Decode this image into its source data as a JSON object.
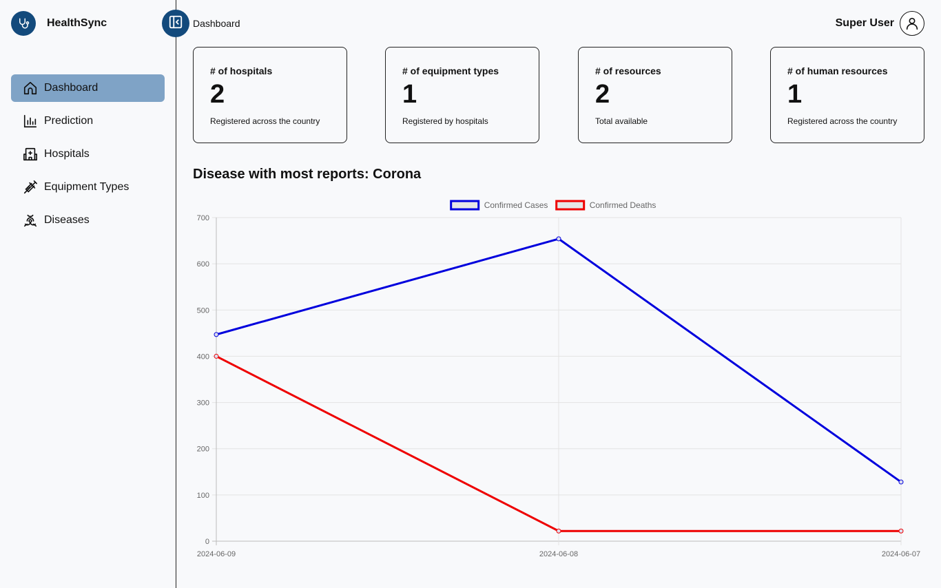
{
  "app": {
    "name": "HealthSync"
  },
  "breadcrumb": "Dashboard",
  "user": {
    "name": "Super User"
  },
  "sidebar": {
    "items": [
      {
        "label": "Dashboard",
        "icon": "home-icon",
        "active": true
      },
      {
        "label": "Prediction",
        "icon": "bar-chart-icon",
        "active": false
      },
      {
        "label": "Hospitals",
        "icon": "hospital-icon",
        "active": false
      },
      {
        "label": "Equipment Types",
        "icon": "syringe-icon",
        "active": false
      },
      {
        "label": "Diseases",
        "icon": "biohazard-icon",
        "active": false
      }
    ]
  },
  "cards": [
    {
      "title": "# of hospitals",
      "value": "2",
      "sub": "Registered across the country"
    },
    {
      "title": "# of equipment types",
      "value": "1",
      "sub": "Registered by hospitals"
    },
    {
      "title": "# of resources",
      "value": "2",
      "sub": "Total available"
    },
    {
      "title": "# of human resources",
      "value": "1",
      "sub": "Registered across the country"
    }
  ],
  "section_title": "Disease with most reports: Corona",
  "colors": {
    "brand": "#134a7c",
    "active_nav": "#7fa3c6",
    "cases": "#0000dd",
    "deaths": "#ee0000"
  },
  "chart_data": {
    "type": "line",
    "x": [
      "2024-06-09",
      "2024-06-08",
      "2024-06-07"
    ],
    "series": [
      {
        "name": "Confirmed Cases",
        "color": "#0000dd",
        "values": [
          447,
          654,
          128
        ]
      },
      {
        "name": "Confirmed Deaths",
        "color": "#ee0000",
        "values": [
          400,
          22,
          22
        ]
      }
    ],
    "ylim": [
      0,
      700
    ],
    "yticks": [
      0,
      100,
      200,
      300,
      400,
      500,
      600,
      700
    ],
    "grid": true,
    "legend": "top-center"
  }
}
